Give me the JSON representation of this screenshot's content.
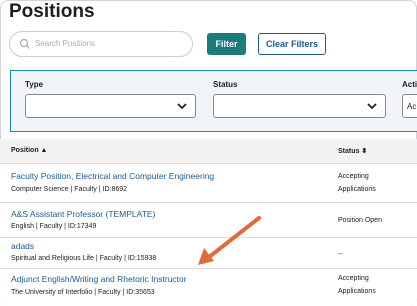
{
  "page": {
    "title": "Positions"
  },
  "search": {
    "placeholder": "Search Positions"
  },
  "toolbar": {
    "filter_label": "Filter",
    "clear_label": "Clear Filters"
  },
  "filters": {
    "type_label": "Type",
    "status_label": "Status",
    "active_label": "Acti",
    "active_value": "Ac"
  },
  "table": {
    "col_position": "Position ▲",
    "col_status": "Status ⬍",
    "rows": [
      {
        "title": "Faculty Position, Electrical and Computer Engineering",
        "meta": "Computer Science  |   Faculty  |   ID:8692",
        "status_line1": "Accepting",
        "status_line2": "Applications"
      },
      {
        "title": "A&S Assistant Professor (TEMPLATE)",
        "meta": "English  |   Faculty  |   ID:17349",
        "status_line1": "Position Open",
        "status_line2": ""
      },
      {
        "title": "adads",
        "meta": "Spiritual and Religious Life  |   Faculty  |   ID:15938",
        "status_line1": "--",
        "status_line2": ""
      },
      {
        "title": "Adjunct English/Writing and Rhetoric Instructor",
        "meta": "The University of Interfolio  |   Faculty  |   ID:35653",
        "status_line1": "Accepting",
        "status_line2": "Applications"
      }
    ]
  },
  "colors": {
    "accent": "#1a7c7b",
    "link": "#1a5c98",
    "annotation_arrow": "#e06a3a"
  }
}
